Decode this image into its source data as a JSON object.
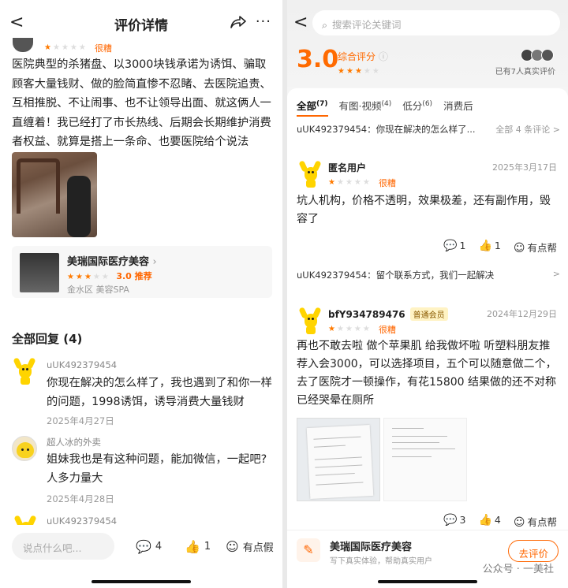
{
  "left": {
    "header": {
      "back": "<",
      "title": "评价详情",
      "more": "···"
    },
    "review": {
      "stars_on": 1,
      "rating_word": "很糟",
      "body": "医院典型的杀猪盘、以3000块钱承诺为诱饵、骗取顾客大量钱财、做的脸简直惨不忍睹、去医院追责、互相推脱、不让闹事、也不让领导出面、就这俩人一直缠着！我已经打了市长热线、后期会长期维护消费者权益、就算是搭上一条命、也要医院给个说法"
    },
    "shop": {
      "name": "美瑞国际医疗美容",
      "rating": "3.0 推荐",
      "stars_on": 3,
      "location": "金水区 美容SPA"
    },
    "replies_title": "全部回复 (4)",
    "replies": [
      {
        "user": "uUK492379454",
        "text": "你现在解决的怎么样了，我也遇到了和你一样的问题，1998诱饵，诱导消费大量钱财",
        "date": "2025年4月27日"
      },
      {
        "user": "超人冰的外卖",
        "text": "姐妹我也是有这种问题，能加微信，一起吧?人多力量大",
        "date": "2025年4月28日"
      },
      {
        "user": "uUK492379454"
      }
    ],
    "bottom": {
      "input_placeholder": "说点什么吧...",
      "comments": "4",
      "likes": "1",
      "useful": "有点假"
    }
  },
  "right": {
    "search_placeholder": "搜索评论关键词",
    "score": "3.0",
    "score_label": "综合评分",
    "score_stars_on": 3,
    "real_reviews": "已有7人真实评价",
    "tabs": [
      {
        "label": "全部",
        "count": "7"
      },
      {
        "label": "有图·视频",
        "count": "4"
      },
      {
        "label": "低分",
        "count": "6"
      },
      {
        "label": "消费后",
        "count": ""
      }
    ],
    "pinned1": {
      "text": "uUK492379454：你现在解决的怎么样了...",
      "more": "全部 4 条评论 >"
    },
    "review1": {
      "user": "匿名用户",
      "date": "2025年3月17日",
      "rating_word": "很糟",
      "text": "坑人机构，价格不透明，效果极差，还有副作用，毁容了",
      "comments": "1",
      "likes": "1",
      "useful": "有点帮"
    },
    "pinned2": {
      "text": "uUK492379454：留个联系方式，我们一起解决",
      "more": ">"
    },
    "review2": {
      "user": "bfY934789476",
      "badge": "普通会员",
      "date": "2024年12月29日",
      "rating_word": "很糟",
      "text": "再也不敢去啦 做个苹果肌 给我做坏啦 听塑料朋友推荐入会3000，可以选择项目，五个可以随意做二个，去了医院才一顿操作，有花15800 结果做的还不对称 已经哭晕在厕所",
      "comments": "3",
      "likes": "4",
      "useful": "有点帮"
    },
    "bottom": {
      "shop_name": "美瑞国际医疗美容",
      "shop_sub": "写下真实体验，帮助真实用户",
      "cta": "去评价",
      "watermark": "公众号 · 一美社"
    }
  }
}
